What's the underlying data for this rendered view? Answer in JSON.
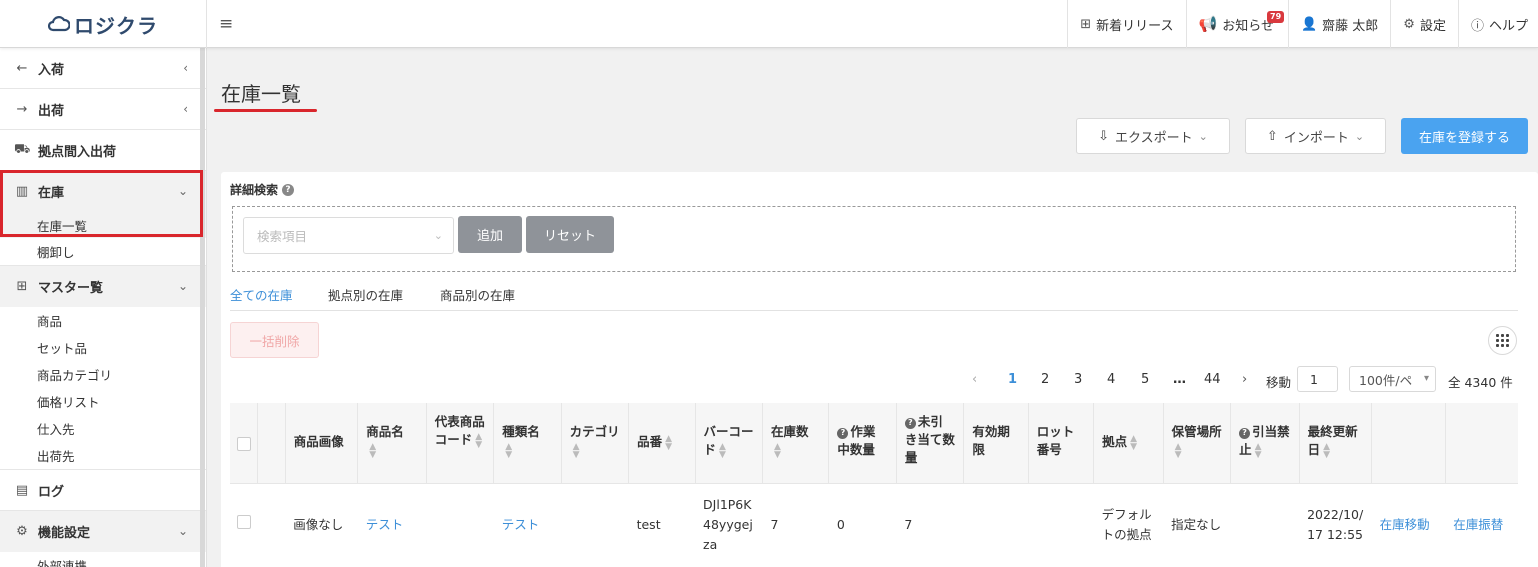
{
  "header": {
    "logo_text": "ロジクラ",
    "menu_icon": "hamburger-icon",
    "release_label": "新着リリース",
    "notice_label": "お知らせ",
    "notice_count": "79",
    "user_name": "齋藤 太郎",
    "settings_label": "設定",
    "help_label": "ヘルプ"
  },
  "sidebar": {
    "inbound": "入荷",
    "outbound": "出荷",
    "transfer": "拠点間入出荷",
    "stock": "在庫",
    "stock_list": "在庫一覧",
    "stocktake": "棚卸し",
    "master": "マスター覧",
    "master_items": [
      "商品",
      "セット品",
      "商品カテゴリ",
      "価格リスト",
      "仕入先",
      "出荷先"
    ],
    "log": "ログ",
    "features": "機能設定",
    "integration": "外部連携"
  },
  "main": {
    "page_title": "在庫一覧",
    "export_label": "エクスポート",
    "import_label": "インポート",
    "register_label": "在庫を登録する",
    "advanced_search": "詳細検索",
    "search_placeholder": "検索項目",
    "add_label": "追加",
    "reset_label": "リセット",
    "tabs": [
      "全ての在庫",
      "拠点別の在庫",
      "商品別の在庫"
    ],
    "bulk_delete": "一括削除"
  },
  "pagination": {
    "pages": [
      "1",
      "2",
      "3",
      "4",
      "5",
      "…",
      "44"
    ],
    "current_page": "1",
    "move_label": "移動",
    "move_value": "1",
    "per_page": "100件/ペ",
    "total": "全 4340 件"
  },
  "table": {
    "headers": {
      "image": "商品画像",
      "name": "商品名",
      "code": "代表商品コード",
      "type": "種類名",
      "category": "カテゴリ",
      "sku": "品番",
      "barcode": "バーコード",
      "qty": "在庫数",
      "in_work": "作業中数量",
      "unallocated": "未引き当て数量",
      "expiry": "有効期限",
      "lot": "ロット番号",
      "location": "拠点",
      "storage": "保管場所",
      "hold": "引当禁止",
      "updated": "最終更新日"
    },
    "rows": [
      {
        "image": "画像なし",
        "name": "テスト",
        "code": "",
        "type": "テスト",
        "category": "",
        "sku": "test",
        "barcode": "DJl1P6K48yygejza",
        "qty": "7",
        "in_work": "0",
        "unallocated": "7",
        "expiry": "",
        "lot": "",
        "location": "デフォルトの拠点",
        "storage": "指定なし",
        "hold": "",
        "updated": "2022/10/17 12:55",
        "action_move": "在庫移動",
        "action_swap": "在庫振替"
      }
    ]
  },
  "colors": {
    "primary": "#4aa3f0",
    "link": "#3d8fd8",
    "highlight": "#d9262c",
    "main_bg": "#f1f1f1"
  }
}
